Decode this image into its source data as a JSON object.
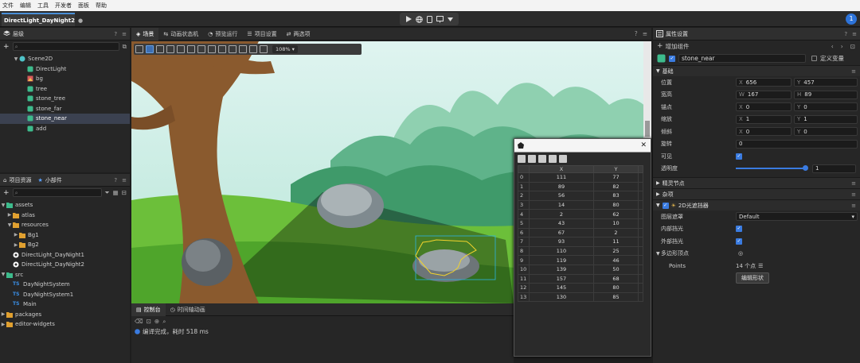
{
  "menu": [
    "文件",
    "编辑",
    "工具",
    "开发者",
    "面板",
    "帮助"
  ],
  "file_tab": {
    "label": "DirectLight_DayNight2",
    "modified_mark": "●"
  },
  "user_badge": "1",
  "hierarchy": {
    "title": "层级",
    "nodes": [
      {
        "label": "Scene2D"
      },
      {
        "label": "DirectLight"
      },
      {
        "label": "bg"
      },
      {
        "label": "tree"
      },
      {
        "label": "stone_tree"
      },
      {
        "label": "stone_far"
      },
      {
        "label": "stone_near"
      },
      {
        "label": "add"
      }
    ]
  },
  "assets": {
    "tabs": [
      "项目资源",
      "小部件"
    ],
    "nodes": [
      {
        "label": "assets"
      },
      {
        "label": "atlas"
      },
      {
        "label": "resources"
      },
      {
        "label": "Bg1"
      },
      {
        "label": "Bg2"
      },
      {
        "label": "DirectLight_DayNight1"
      },
      {
        "label": "DirectLight_DayNight2"
      },
      {
        "label": "src"
      },
      {
        "label": "DayNightSystem"
      },
      {
        "label": "DayNightSystem1"
      },
      {
        "label": "Main"
      },
      {
        "label": "packages"
      },
      {
        "label": "editor-widgets"
      }
    ]
  },
  "scene": {
    "tabs": [
      "场景",
      "动画状态机",
      "预览运行",
      "项目设置",
      "两选项"
    ],
    "zoom": "108%"
  },
  "console": {
    "tabs": [
      "控制台",
      "时间轴动画"
    ],
    "message": "编译完成，耗时 518 ms"
  },
  "points_dialog": {
    "columns": [
      "X",
      "Y"
    ],
    "rows": [
      [
        0,
        111,
        77
      ],
      [
        1,
        89,
        82
      ],
      [
        2,
        56,
        83
      ],
      [
        3,
        14,
        80
      ],
      [
        4,
        2,
        62
      ],
      [
        5,
        43,
        10
      ],
      [
        6,
        67,
        2
      ],
      [
        7,
        93,
        11
      ],
      [
        8,
        110,
        25
      ],
      [
        9,
        119,
        46
      ],
      [
        10,
        139,
        50
      ],
      [
        11,
        157,
        68
      ],
      [
        12,
        145,
        80
      ],
      [
        13,
        130,
        85
      ]
    ]
  },
  "properties": {
    "title": "属性设置",
    "add_component": "增加组件",
    "node_name": "stone_near",
    "define_var": "定义变量",
    "section_basic": "基础",
    "position": {
      "label": "位置",
      "x": "656",
      "y": "457"
    },
    "size": {
      "label": "宽高",
      "w": "167",
      "h": "89"
    },
    "anchor": {
      "label": "锚点",
      "x": "0",
      "y": "0"
    },
    "scale": {
      "label": "缩放",
      "x": "1",
      "y": "1"
    },
    "skew": {
      "label": "倾斜",
      "x": "0",
      "y": "0"
    },
    "rotation": {
      "label": "旋转",
      "value": "0"
    },
    "visible": {
      "label": "可见"
    },
    "alpha": {
      "label": "透明度",
      "value": "1",
      "fraction": 1
    },
    "section_sprite": "精灵节点",
    "section_misc": "杂项",
    "section_light": "2D光遮挡器",
    "layer_mask": {
      "label": "图层遮罩",
      "value": "Default"
    },
    "inner_shadow": {
      "label": "内部挡光"
    },
    "outer_shadow": {
      "label": "外部挡光"
    },
    "poly_points": {
      "label": "多边形顶点"
    },
    "points": {
      "label": "Points",
      "count": "14 个点"
    },
    "edit_shape": "编辑形状"
  },
  "colors": {
    "accent": "#3a7be0",
    "selection": "#3b4150",
    "poly": "#f2d32c"
  }
}
